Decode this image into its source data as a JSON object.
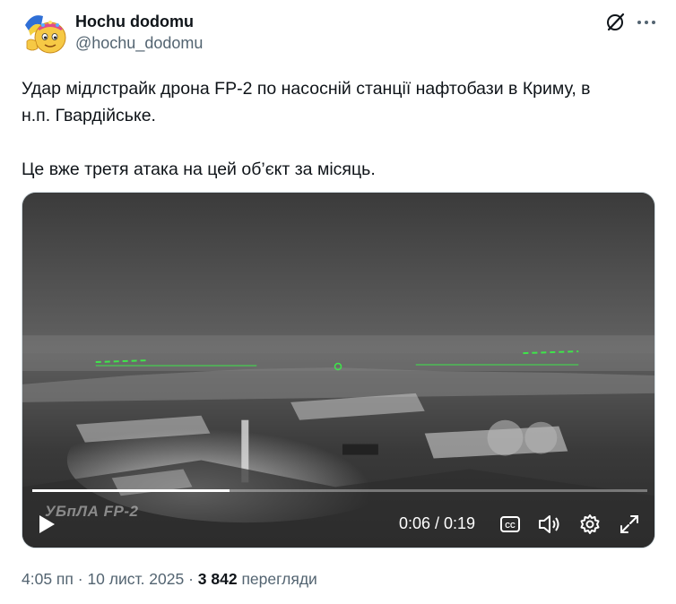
{
  "author": {
    "name": "Hochu dodomu",
    "handle": "@hochu_dodomu"
  },
  "header_icons": [
    "grok-icon",
    "more-icon"
  ],
  "tweet": {
    "text": "Удар мідлстрайк дрона FP-2 по насосній станції нафтобази в Криму, в\nн.п. Гвардійське.\n\nЦе вже третя атака на цей об’єкт за місяць."
  },
  "video": {
    "watermark": "УБпЛА FP-2",
    "time_label": "0:06 / 0:19",
    "progress_fraction": 0.32,
    "controls": [
      "play-icon",
      "captions-icon",
      "volume-icon",
      "settings-icon",
      "fullscreen-icon"
    ]
  },
  "meta": {
    "time": "4:05 пп",
    "sep1": " · ",
    "date": "10 лист. 2025",
    "sep2": " · ",
    "views_count": "3 842",
    "views_label": " перегляди"
  },
  "colors": {
    "text_primary": "#0f1419",
    "text_secondary": "#536471",
    "hud_green": "#3ee64a"
  }
}
